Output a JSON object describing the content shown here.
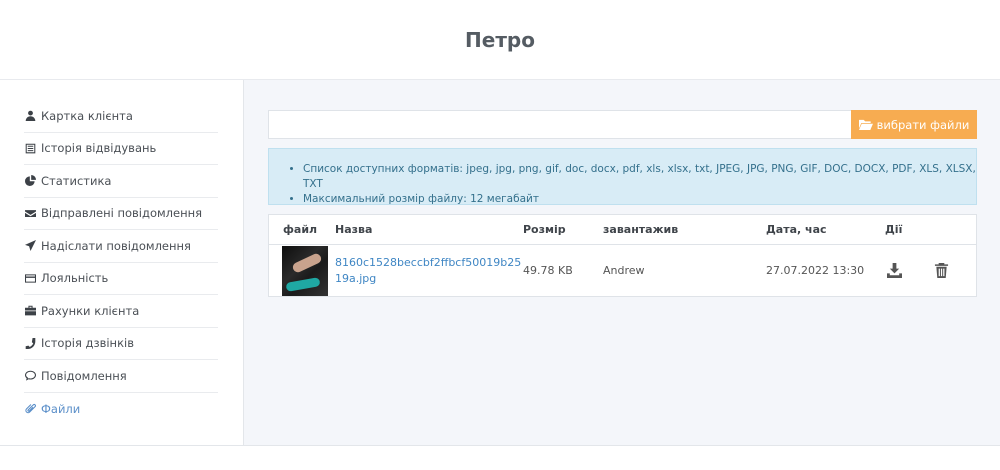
{
  "header": {
    "title": "Петро"
  },
  "sidebar": {
    "items": [
      {
        "label": "Картка клієнта",
        "icon": "user-icon"
      },
      {
        "label": "Історія відвідувань",
        "icon": "list-icon"
      },
      {
        "label": "Статистика",
        "icon": "pie-chart-icon"
      },
      {
        "label": "Відправлені повідомлення",
        "icon": "envelope-icon"
      },
      {
        "label": "Надіслати повідомлення",
        "icon": "send-icon"
      },
      {
        "label": "Лояльність",
        "icon": "credit-card-icon"
      },
      {
        "label": "Рахунки клієнта",
        "icon": "briefcase-icon"
      },
      {
        "label": "Історія дзвінків",
        "icon": "phone-icon"
      },
      {
        "label": "Повідомлення",
        "icon": "comment-icon"
      },
      {
        "label": "Файли",
        "icon": "paperclip-icon",
        "active": true
      }
    ]
  },
  "upload": {
    "button_label": "вибрати файли",
    "value": ""
  },
  "info": {
    "formats": "Список доступних форматів: jpeg, jpg, png, gif, doc, docx, pdf, xls, xlsx, txt, JPEG, JPG, PNG, GIF, DOC, DOCX, PDF, XLS, XLSX, TXT",
    "max_size": "Максимальний розмір файлу: 12 мегабайт"
  },
  "table": {
    "headers": {
      "file": "файл",
      "name": "Назва",
      "size": "Розмір",
      "uploaded_by": "завантажив",
      "date": "Дата, час",
      "actions": "Дії"
    },
    "rows": [
      {
        "name": "8160c1528beccbf2ffbcf50019b2519a.jpg",
        "size": "49.78 KB",
        "uploaded_by": "Andrew",
        "date": "27.07.2022 13:30"
      }
    ]
  },
  "colors": {
    "accent": "#f7ac51",
    "link": "#3f86c4",
    "info_bg": "#d8ecf6",
    "active_nav": "#5b8fc9"
  }
}
